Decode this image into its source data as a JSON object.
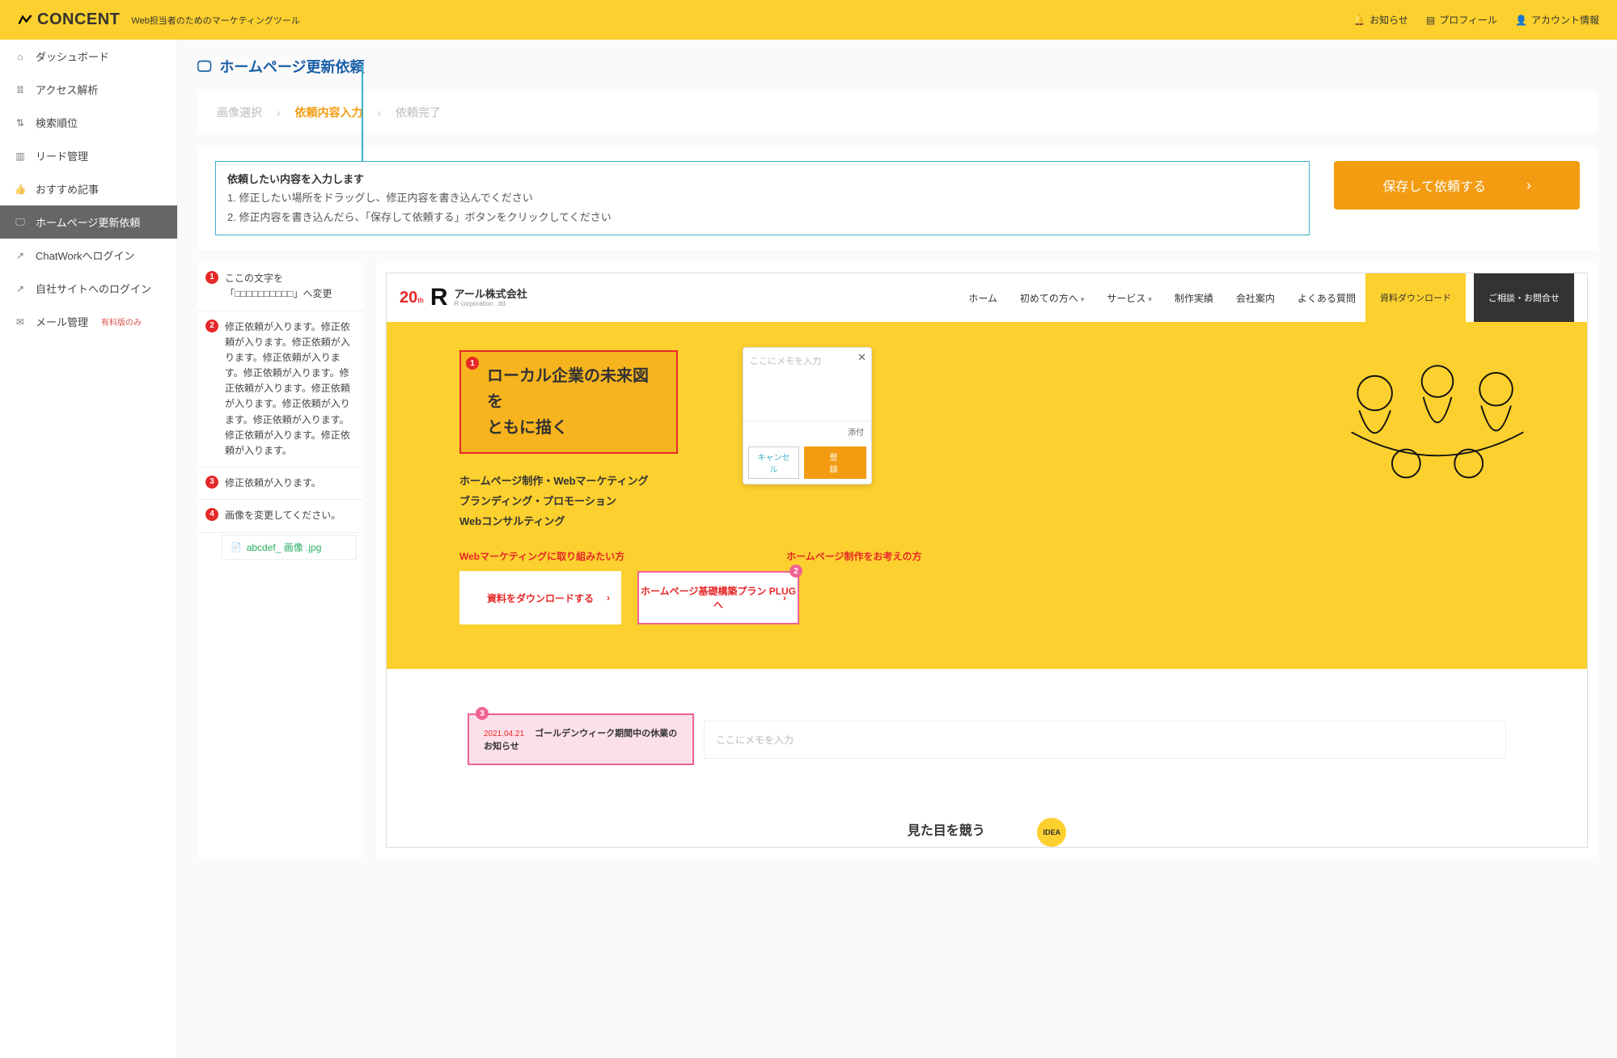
{
  "header": {
    "logo": "CONCENT",
    "tagline": "Web担当者のためのマーケティングツール",
    "notice": "お知らせ",
    "profile": "プロフィール",
    "account": "アカウント情報"
  },
  "sidebar": {
    "items": [
      {
        "icon": "home",
        "label": "ダッシュボード"
      },
      {
        "icon": "chart",
        "label": "アクセス解析"
      },
      {
        "icon": "updown",
        "label": "検索順位"
      },
      {
        "icon": "book",
        "label": "リード管理"
      },
      {
        "icon": "thumb",
        "label": "おすすめ記事"
      },
      {
        "icon": "monitor",
        "label": "ホームページ更新依頼",
        "active": true
      },
      {
        "icon": "ext",
        "label": "ChatWorkへログイン"
      },
      {
        "icon": "ext",
        "label": "自社サイトへのログイン"
      },
      {
        "icon": "mail",
        "label": "メール管理",
        "tag": "有料版のみ"
      }
    ]
  },
  "page": {
    "title": "ホームページ更新依頼",
    "breadcrumb": {
      "a": "画像選択",
      "b": "依頼内容入力",
      "c": "依頼完了"
    },
    "instruction": {
      "title": "依頼したい内容を入力します",
      "line1": "1. 修正したい場所をドラッグし、修正内容を書き込んでください",
      "line2": "2. 修正内容を書き込んだら、「保存して依頼する」ボタンをクリックしてください"
    },
    "submit": "保存して依頼する"
  },
  "annotations": [
    {
      "n": "1",
      "text": "ここの文字を「□□□□□□□□□□」へ変更"
    },
    {
      "n": "2",
      "text": "修正依頼が入ります。修正依頼が入ります。修正依頼が入ります。修正依頼が入ります。修正依頼が入ります。修正依頼が入ります。修正依頼が入ります。修正依頼が入ります。修正依頼が入ります。修正依頼が入ります。修正依頼が入ります。"
    },
    {
      "n": "3",
      "text": "修正依頼が入ります。"
    },
    {
      "n": "4",
      "text": "画像を変更してください。",
      "file": "abcdef_ 画像 .jpg"
    }
  ],
  "preview": {
    "company": "アール株式会社",
    "company_en": "R corporation ..ltd.",
    "nav": [
      "ホーム",
      "初めての方へ",
      "サービス",
      "制作実績",
      "会社案内",
      "よくある質問"
    ],
    "cta1": "資料ダウンロード",
    "cta2": "ご相談・お問合せ",
    "hero_h1_a": "ローカル企業の未来図を",
    "hero_h1_b": "ともに描く",
    "hero_sub1": "ホームページ制作・Webマーケティング",
    "hero_sub2": "ブランディング・プロモーション",
    "hero_sub3": "Webコンサルティング",
    "hero_link1": "Webマーケティングに取り組みたい方",
    "hero_link2": "ホームページ制作をお考えの方",
    "hero_btn1": "資料をダウンロードする",
    "hero_btn2": "ホームページ基礎構築プラン PLUGへ",
    "news_date": "2021.04.21",
    "news_title": "ゴールデンウィーク期間中の休業のお知らせ",
    "memo_placeholder": "ここにメモを入力",
    "memo_attach": "添付",
    "memo_cancel": "キャンセル",
    "memo_save": "登録",
    "footer": "見た目を競う",
    "idea": "IDEA"
  }
}
